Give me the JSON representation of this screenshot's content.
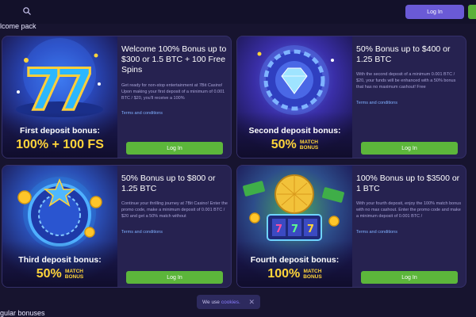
{
  "topbar": {
    "login_label": "Log In"
  },
  "section": {
    "title": "lcome pack",
    "bottom_title": "gular bonuses"
  },
  "cards": [
    {
      "title": "Welcome 100% Bonus up to $300 or 1.5 BTC + 100 Free Spins",
      "description": "Get ready for non-stop entertainment at 7Bit Casino! Upon making your first deposit of a minimum of 0.001 BTC / $20, you'll receive a 100%",
      "terms": "Terms and conditions",
      "deposit_label": "First deposit bonus:",
      "bonus_value": "100% + 100 FS",
      "match_line1": "",
      "match_line2": "",
      "login_label": "Log In",
      "art_icon": "lucky-sevens-icon"
    },
    {
      "title": "50% Bonus up to $400 or 1.25 BTC",
      "description": "With the second deposit of a minimum 0.001 BTC / $20, your funds will be enhanced with a 50% bonus that has no maximum cashout! Free",
      "terms": "Terms and conditions",
      "deposit_label": "Second deposit bonus:",
      "bonus_value": "50%",
      "match_line1": "MATCH",
      "match_line2": "BONUS",
      "login_label": "Log In",
      "art_icon": "diamond-chip-icon"
    },
    {
      "title": "50% Bonus up to $800 or 1.25 BTC",
      "description": "Continue your thrilling journey at 7Bit Casino! Enter the promo code, make a minimum deposit of 0.001 BTC / $20 and get a 50% match without",
      "terms": "Terms and conditions",
      "deposit_label": "Third deposit bonus:",
      "bonus_value": "50%",
      "match_line1": "MATCH",
      "match_line2": "BONUS",
      "login_label": "Log In",
      "art_icon": "roulette-wheel-icon"
    },
    {
      "title": "100% Bonus up to $3500 or 1 BTC",
      "description": "With your fourth deposit, enjoy the 100% match bonus with no max cashout. Enter the promo code and make a minimum deposit of 0.001 BTC /",
      "terms": "Terms and conditions",
      "deposit_label": "Fourth deposit bonus:",
      "bonus_value": "100%",
      "match_line1": "MATCH",
      "match_line2": "BONUS",
      "login_label": "Log In",
      "art_icon": "disco-ball-slot-icon"
    }
  ],
  "cookie": {
    "text": "We use",
    "link": "cookies.",
    "close": "✕"
  },
  "colors": {
    "accent_purple": "#6a5ad6",
    "login_green": "#5cb63b",
    "bonus_yellow": "#ffd43a",
    "card_bg": "#262250"
  }
}
